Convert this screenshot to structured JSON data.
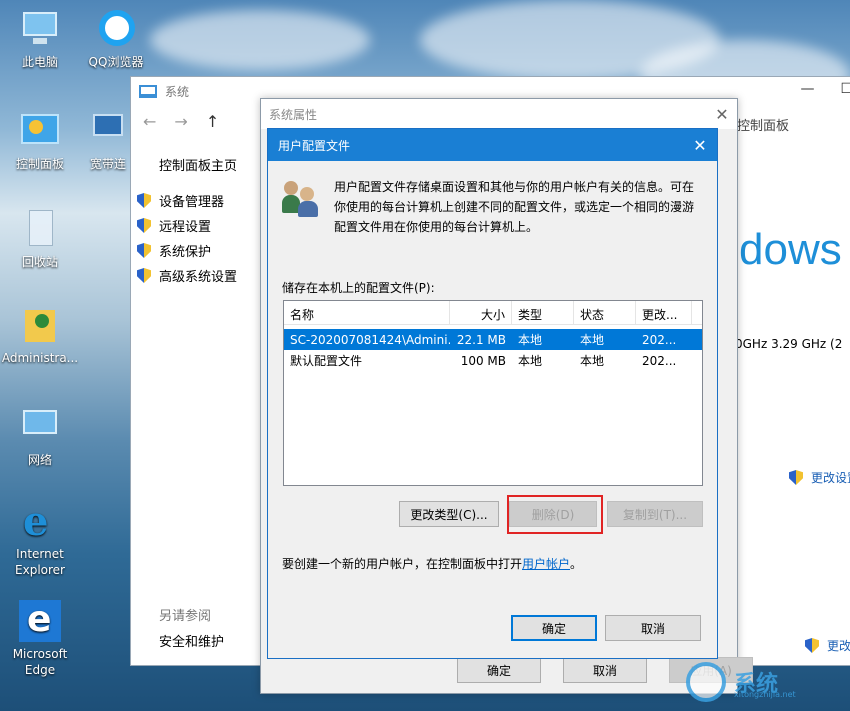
{
  "desktop": {
    "icons": [
      {
        "label": "此电脑",
        "icon": "computer-icon"
      },
      {
        "label": "QQ浏览器",
        "icon": "qq-browser-icon"
      },
      {
        "label": "控制面板",
        "icon": "control-panel-icon"
      },
      {
        "label": "宽带连",
        "icon": "broadband-icon"
      },
      {
        "label": "回收站",
        "icon": "recycle-bin-icon"
      },
      {
        "label": "Administra...",
        "icon": "user-folder-icon"
      },
      {
        "label": "网络",
        "icon": "network-icon"
      },
      {
        "label": "Internet Explorer",
        "icon": "ie-icon"
      },
      {
        "label": "Microsoft Edge",
        "icon": "edge-icon"
      }
    ]
  },
  "system_window": {
    "title": "系统",
    "nav_home": "控制面板主页",
    "nav_items": [
      "设备管理器",
      "远程设置",
      "系统保护",
      "高级系统设置"
    ],
    "see_also": "另请参阅",
    "security_link": "安全和维护",
    "breadcrumb_tail": "控制面板",
    "windows_logo_text": "dows",
    "cpu_speed": "0GHz   3.29 GHz  (2",
    "change_settings": "更改设置",
    "change_key": "更改"
  },
  "properties_window": {
    "title": "系统属性",
    "ok": "确定",
    "cancel": "取消",
    "apply": "应用(A)"
  },
  "profiles_dialog": {
    "title": "用户配置文件",
    "intro": "用户配置文件存储桌面设置和其他与你的用户帐户有关的信息。可在你使用的每台计算机上创建不同的配置文件，或选定一个相同的漫游配置文件用在你使用的每台计算机上。",
    "list_label": "储存在本机上的配置文件(P):",
    "columns": [
      "名称",
      "大小",
      "类型",
      "状态",
      "更改..."
    ],
    "rows": [
      {
        "name": "SC-202007081424\\Admini...",
        "size": "22.1 MB",
        "type": "本地",
        "state": "本地",
        "modified": "202..."
      },
      {
        "name": "默认配置文件",
        "size": "100 MB",
        "type": "本地",
        "state": "本地",
        "modified": "202..."
      }
    ],
    "change_type_btn": "更改类型(C)...",
    "delete_btn": "删除(D)",
    "copy_to_btn": "复制到(T)...",
    "create_note_prefix": "要创建一个新的用户帐户，在控制面板中打开",
    "create_note_link": "用户帐户",
    "create_note_suffix": "。",
    "ok": "确定",
    "cancel": "取消"
  },
  "watermark": {
    "text": "系统",
    "url": "xitongzhijia.net"
  }
}
